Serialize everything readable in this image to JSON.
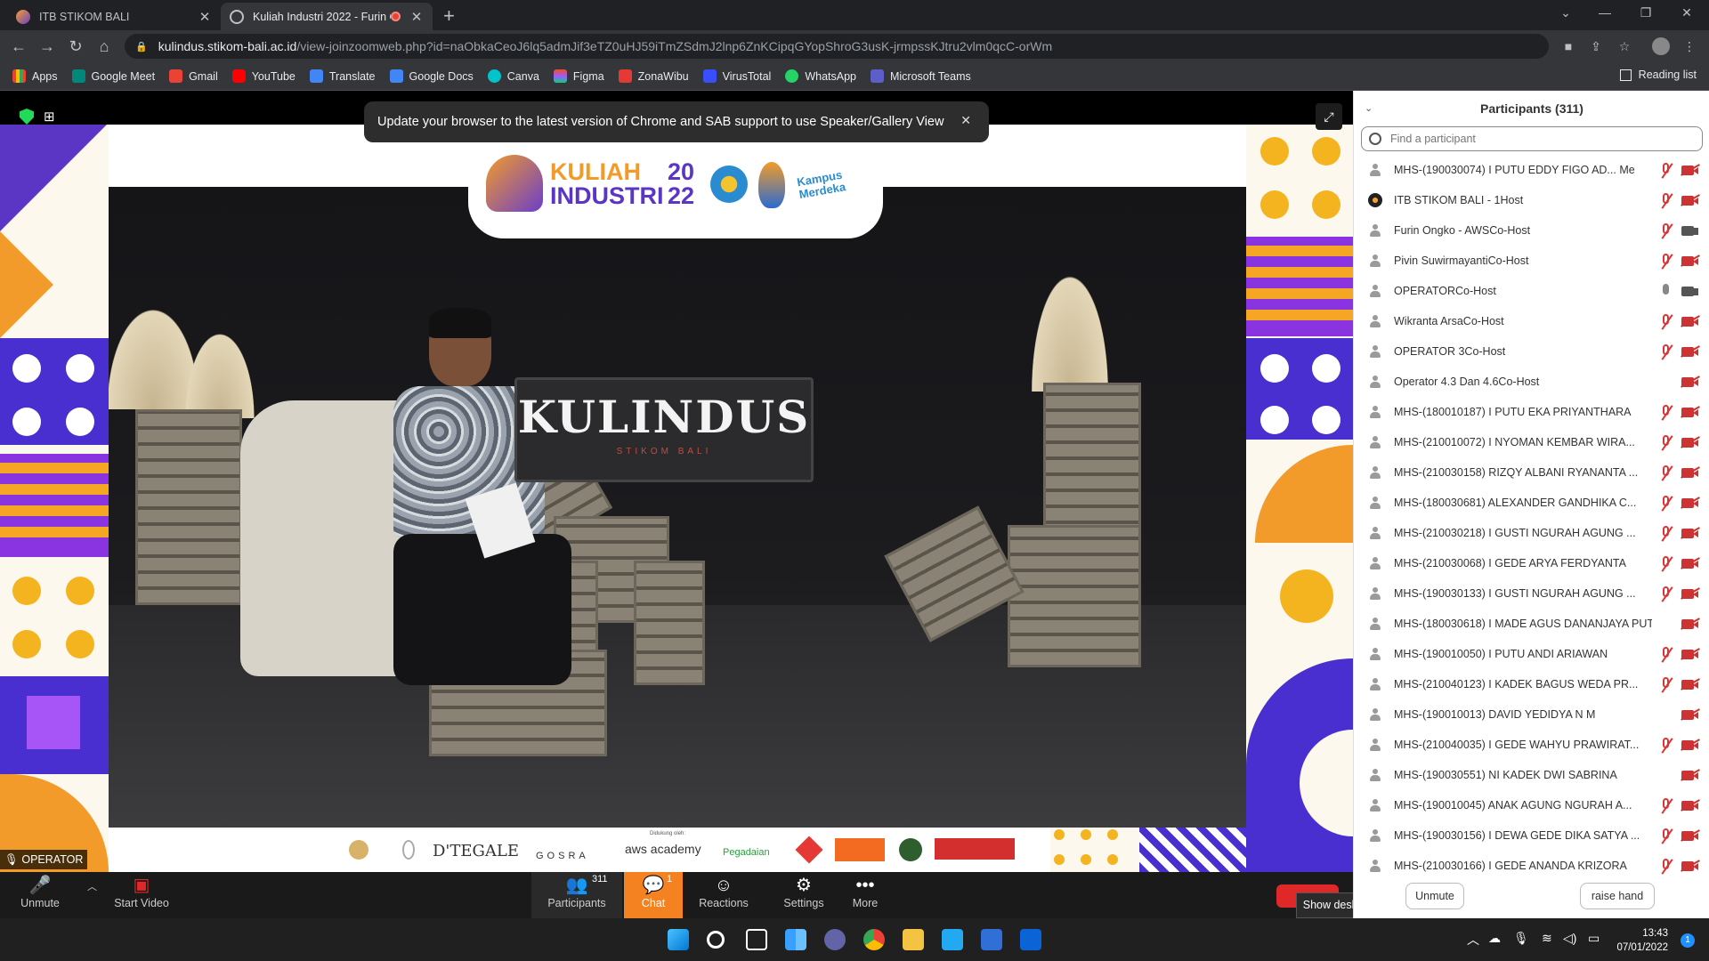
{
  "browser": {
    "tabs": [
      {
        "label": "ITB STIKOM BALI",
        "active": false
      },
      {
        "label": "Kuliah Industri 2022 - Furin O",
        "active": true
      }
    ],
    "url_host": "kulindus.stikom-bali.ac.id",
    "url_path": "/view-joinzoomweb.php?id=naObkaCeoJ6lq5admJif3eTZ0uHJ59iTmZSdmJ2lnp6ZnKCipqGYopShroG3usK-jrmpssKJtru2vlm0qcC-orWm",
    "bookmarks": [
      "Apps",
      "Google Meet",
      "Gmail",
      "YouTube",
      "Translate",
      "Google Docs",
      "Canva",
      "Figma",
      "ZonaWibu",
      "VirusTotal",
      "WhatsApp",
      "Microsoft Teams"
    ],
    "reading_list": "Reading list"
  },
  "meeting": {
    "update_banner": "Update your browser to the latest version of Chrome and SAB support to use Speaker/Gallery View",
    "video_label": "OPERATOR",
    "stage_sign": "KULINDUS",
    "stage_sign_sub": "STIKOM BALI",
    "logo": {
      "line1": "KULIAH",
      "line2": "INDUSTRI",
      "year_top": "20",
      "year_bottom": "22",
      "kampus": "Kampus Merdeka"
    },
    "sponsor_head": "Didukung oleh:",
    "sponsors": [
      "D'TEGALE",
      "GOSRA",
      "aws academy",
      "Pegadaian"
    ]
  },
  "footer": {
    "unmute": "Unmute",
    "start_video": "Start Video",
    "participants": "Participants",
    "participants_count": "311",
    "chat": "Chat",
    "chat_badge": "1",
    "reactions": "Reactions",
    "settings": "Settings",
    "more": "More",
    "show_desktop": "Show desktop"
  },
  "panel": {
    "title": "Participants (311)",
    "search_placeholder": "Find a participant",
    "unmute_btn": "Unmute",
    "raise_hand_btn": "raise hand",
    "participants": [
      {
        "name": "MHS-(190030074) I PUTU EDDY FIGO AD... Me",
        "mic": "muted",
        "cam": "off",
        "avatar": "generic"
      },
      {
        "name": "ITB STIKOM BALI - 1Host",
        "mic": "muted",
        "cam": "off",
        "avatar": "host"
      },
      {
        "name": "Furin Ongko - AWSCo-Host",
        "mic": "muted",
        "cam": "on",
        "avatar": "generic"
      },
      {
        "name": "Pivin SuwirmayantiCo-Host",
        "mic": "muted",
        "cam": "off",
        "avatar": "generic"
      },
      {
        "name": "OPERATORCo-Host",
        "mic": "on",
        "cam": "on",
        "avatar": "generic"
      },
      {
        "name": "Wikranta ArsaCo-Host",
        "mic": "muted",
        "cam": "off",
        "avatar": "generic"
      },
      {
        "name": "OPERATOR 3Co-Host",
        "mic": "muted",
        "cam": "off",
        "avatar": "generic"
      },
      {
        "name": "Operator 4.3 Dan 4.6Co-Host",
        "mic": "none",
        "cam": "off",
        "avatar": "generic"
      },
      {
        "name": "MHS-(180010187) I PUTU EKA PRIYANTHARA",
        "mic": "muted",
        "cam": "off",
        "avatar": "generic"
      },
      {
        "name": "MHS-(210010072) I NYOMAN KEMBAR WIRA...",
        "mic": "muted",
        "cam": "off",
        "avatar": "generic"
      },
      {
        "name": "MHS-(210030158) RIZQY ALBANI RYANANTA ...",
        "mic": "muted",
        "cam": "off",
        "avatar": "generic"
      },
      {
        "name": "MHS-(180030681) ALEXANDER GANDHIKA C...",
        "mic": "muted",
        "cam": "off",
        "avatar": "generic"
      },
      {
        "name": "MHS-(210030218) I GUSTI NGURAH AGUNG ...",
        "mic": "muted",
        "cam": "off",
        "avatar": "generic"
      },
      {
        "name": "MHS-(210030068) I GEDE ARYA FERDYANTA",
        "mic": "muted",
        "cam": "off",
        "avatar": "generic"
      },
      {
        "name": "MHS-(190030133) I GUSTI NGURAH AGUNG ...",
        "mic": "muted",
        "cam": "off",
        "avatar": "generic"
      },
      {
        "name": "MHS-(180030618) I MADE AGUS DANANJAYA PUT...",
        "mic": "none",
        "cam": "off",
        "avatar": "generic"
      },
      {
        "name": "MHS-(190010050) I PUTU ANDI ARIAWAN",
        "mic": "muted",
        "cam": "off",
        "avatar": "generic"
      },
      {
        "name": "MHS-(210040123) I KADEK BAGUS WEDA PR...",
        "mic": "muted",
        "cam": "off",
        "avatar": "generic"
      },
      {
        "name": "MHS-(190010013) DAVID YEDIDYA N M",
        "mic": "none",
        "cam": "off",
        "avatar": "generic"
      },
      {
        "name": "MHS-(210040035) I GEDE WAHYU PRAWIRAT...",
        "mic": "muted",
        "cam": "off",
        "avatar": "generic"
      },
      {
        "name": "MHS-(190030551) NI KADEK DWI SABRINA",
        "mic": "none",
        "cam": "off",
        "avatar": "generic"
      },
      {
        "name": "MHS-(190010045) ANAK AGUNG NGURAH A...",
        "mic": "muted",
        "cam": "off",
        "avatar": "generic"
      },
      {
        "name": "MHS-(190030156) I DEWA GEDE DIKA SATYA ...",
        "mic": "muted",
        "cam": "off",
        "avatar": "generic"
      },
      {
        "name": "MHS-(210030166) I GEDE ANANDA KRIZORA",
        "mic": "muted",
        "cam": "off",
        "avatar": "generic"
      }
    ]
  },
  "taskbar": {
    "time": "13:43",
    "date": "07/01/2022",
    "notifications": "1"
  }
}
